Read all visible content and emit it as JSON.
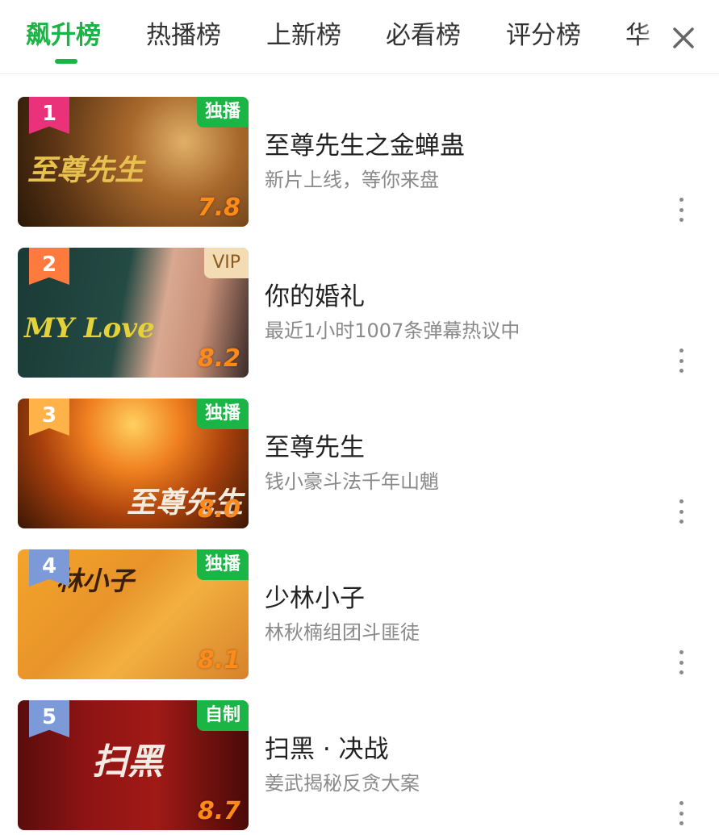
{
  "tabs": [
    {
      "label": "飙升榜",
      "active": true
    },
    {
      "label": "热播榜",
      "active": false
    },
    {
      "label": "上新榜",
      "active": false
    },
    {
      "label": "必看榜",
      "active": false
    },
    {
      "label": "评分榜",
      "active": false
    },
    {
      "label": "华",
      "active": false
    }
  ],
  "close_icon": "close-icon",
  "accent_color": "#1bb546",
  "items": [
    {
      "rank": "1",
      "rank_color": "#e9327a",
      "tag": "独播",
      "tag_style": "green",
      "score": "7.8",
      "poster_text": "至尊先生",
      "title": "至尊先生之金蝉蛊",
      "subtitle": "新片上线，等你来盘"
    },
    {
      "rank": "2",
      "rank_color": "#ff7a3d",
      "tag": "VIP",
      "tag_style": "vip",
      "score": "8.2",
      "poster_text": "MY Love",
      "title": "你的婚礼",
      "subtitle": "最近1小时1007条弹幕热议中"
    },
    {
      "rank": "3",
      "rank_color": "#ffb248",
      "tag": "独播",
      "tag_style": "green",
      "score": "8.0",
      "poster_text": "至尊先生",
      "title": "至尊先生",
      "subtitle": "钱小豪斗法千年山魈"
    },
    {
      "rank": "4",
      "rank_color": "#7c9ad8",
      "tag": "独播",
      "tag_style": "green",
      "score": "8.1",
      "poster_text": "林小子",
      "title": "少林小子",
      "subtitle": "林秋楠组团斗匪徒"
    },
    {
      "rank": "5",
      "rank_color": "#7c9ad8",
      "tag": "自制",
      "tag_style": "green",
      "score": "8.7",
      "poster_text": "扫黑",
      "title": "扫黑 · 决战",
      "subtitle": "姜武揭秘反贪大案"
    }
  ]
}
